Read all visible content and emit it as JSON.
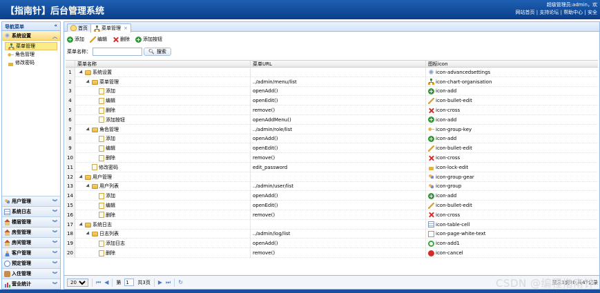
{
  "header": {
    "title": "【指南针】后台管理系统",
    "admin_text": "超级管理员:admin，欢",
    "links": [
      "网站首页",
      "支持论坛",
      "帮助中心",
      "安全"
    ]
  },
  "nav": {
    "title": "导航菜单",
    "open_section": "系统设置",
    "sub_items": [
      "菜单管理",
      "角色管理",
      "修改密码"
    ],
    "sections": [
      "用户管理",
      "系统日志",
      "楼层管理",
      "房型管理",
      "房间管理",
      "客户管理",
      "预定管理",
      "入住管理",
      "营业统计"
    ]
  },
  "tabs": [
    "首页",
    "菜单管理"
  ],
  "toolbar": {
    "add": "添加",
    "edit": "编辑",
    "delete": "删除",
    "add_button": "添加按钮"
  },
  "search": {
    "label": "菜单名称：",
    "value": "",
    "button": "搜索"
  },
  "grid": {
    "columns": [
      "菜单名称",
      "菜单URL",
      "图标icon"
    ],
    "rows": [
      {
        "num": "1",
        "name": "系统设置",
        "url": "",
        "icon": "icon-advancedsettings"
      },
      {
        "num": "2",
        "name": "菜单管理",
        "url": "../admin/menu/list",
        "icon": "icon-chart-organisation"
      },
      {
        "num": "3",
        "name": "添加",
        "url": "openAdd()",
        "icon": "icon-add"
      },
      {
        "num": "4",
        "name": "编辑",
        "url": "openEdit()",
        "icon": "icon-bullet-edit"
      },
      {
        "num": "5",
        "name": "删除",
        "url": "remove()",
        "icon": "icon-cross"
      },
      {
        "num": "6",
        "name": "添加按钮",
        "url": "openAddMenu()",
        "icon": "icon-add"
      },
      {
        "num": "7",
        "name": "角色管理",
        "url": "../admin/role/list",
        "icon": "icon-group-key"
      },
      {
        "num": "8",
        "name": "添加",
        "url": "openAdd()",
        "icon": "icon-add"
      },
      {
        "num": "9",
        "name": "编辑",
        "url": "openEdit()",
        "icon": "icon-bullet-edit"
      },
      {
        "num": "10",
        "name": "删除",
        "url": "remove()",
        "icon": "icon-cross"
      },
      {
        "num": "11",
        "name": "修改密码",
        "url": "edit_password",
        "icon": "icon-lock-edit"
      },
      {
        "num": "12",
        "name": "用户管理",
        "url": "",
        "icon": "icon-group-gear"
      },
      {
        "num": "13",
        "name": "用户列表",
        "url": "../admin/user/list",
        "icon": "icon-group"
      },
      {
        "num": "14",
        "name": "添加",
        "url": "openAdd()",
        "icon": "icon-add"
      },
      {
        "num": "15",
        "name": "编辑",
        "url": "openEdit()",
        "icon": "icon-bullet-edit"
      },
      {
        "num": "16",
        "name": "删除",
        "url": "remove()",
        "icon": "icon-cross"
      },
      {
        "num": "17",
        "name": "系统日志",
        "url": "",
        "icon": "icon-table-cell"
      },
      {
        "num": "18",
        "name": "日志列表",
        "url": "../admin/log/list",
        "icon": "icon-page-white-text"
      },
      {
        "num": "19",
        "name": "添加日志",
        "url": "openAdd()",
        "icon": "icon-add1"
      },
      {
        "num": "20",
        "name": "删除",
        "url": "remove()",
        "icon": "icon-cancel"
      }
    ]
  },
  "pager": {
    "page_size": "20",
    "page_label": "第",
    "page_value": "1",
    "total_label": "共3页",
    "info": "显示1到20,共42记录"
  },
  "watermark": "CSDN @编程指南针"
}
